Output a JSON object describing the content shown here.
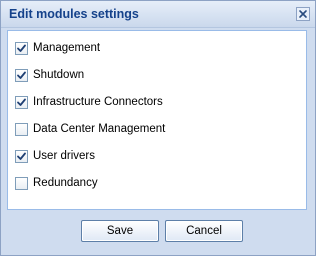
{
  "dialog": {
    "title": "Edit modules settings",
    "close_icon": "close-icon"
  },
  "modules": [
    {
      "label": "Management",
      "checked": true
    },
    {
      "label": "Shutdown",
      "checked": true
    },
    {
      "label": "Infrastructure Connectors",
      "checked": true
    },
    {
      "label": "Data Center Management",
      "checked": false
    },
    {
      "label": "User drivers",
      "checked": true
    },
    {
      "label": "Redundancy",
      "checked": false
    }
  ],
  "buttons": {
    "save_label": "Save",
    "cancel_label": "Cancel"
  },
  "colors": {
    "title_text": "#15428b",
    "frame_background": "#cfdcef",
    "content_border": "#99bbe8",
    "check_mark": "#1f3f73"
  }
}
